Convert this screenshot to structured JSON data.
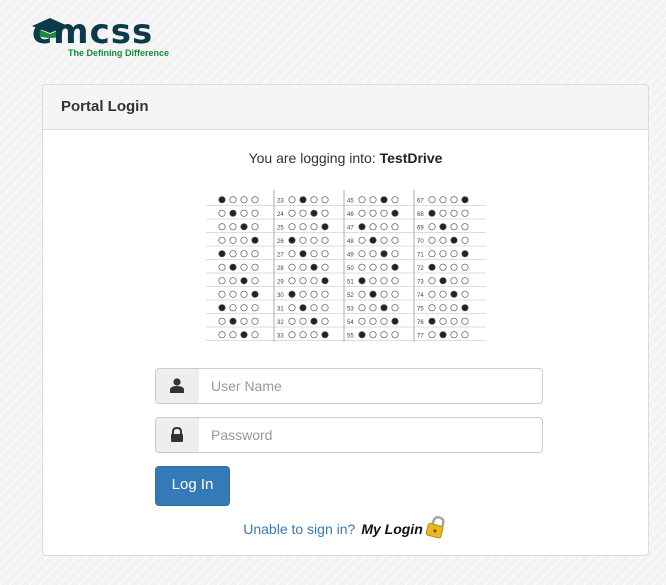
{
  "logo": {
    "brand": "cmcss",
    "tagline": "The Defining Difference",
    "icon": "graduation-cap-icon"
  },
  "panel": {
    "title": "Portal Login"
  },
  "login_target": {
    "prefix": "You are logging into:",
    "name": "TestDrive"
  },
  "bubble_sheet": {
    "icon": "bubble-answer-sheet-image",
    "row_numbers": [
      "23",
      "24",
      "25",
      "26",
      "27",
      "28",
      "29",
      "30",
      "31",
      "32",
      "33",
      "45",
      "46",
      "47",
      "48",
      "49",
      "50",
      "51",
      "52",
      "53",
      "54",
      "55",
      "67",
      "68",
      "69",
      "70",
      "71",
      "72",
      "73",
      "74",
      "75",
      "76",
      "77"
    ]
  },
  "form": {
    "username": {
      "placeholder": "User Name",
      "value": "",
      "icon": "user-icon"
    },
    "password": {
      "placeholder": "Password",
      "value": "",
      "icon": "lock-icon"
    },
    "login_label": "Log In"
  },
  "help": {
    "unable_text": "Unable to sign in?",
    "mylogin_text": "My Login",
    "mylogin_icon": "gold-padlock-icon"
  },
  "colors": {
    "primary": "#337ab7",
    "logo_dark": "#0b3a4a",
    "logo_green": "#1a8a3a"
  }
}
